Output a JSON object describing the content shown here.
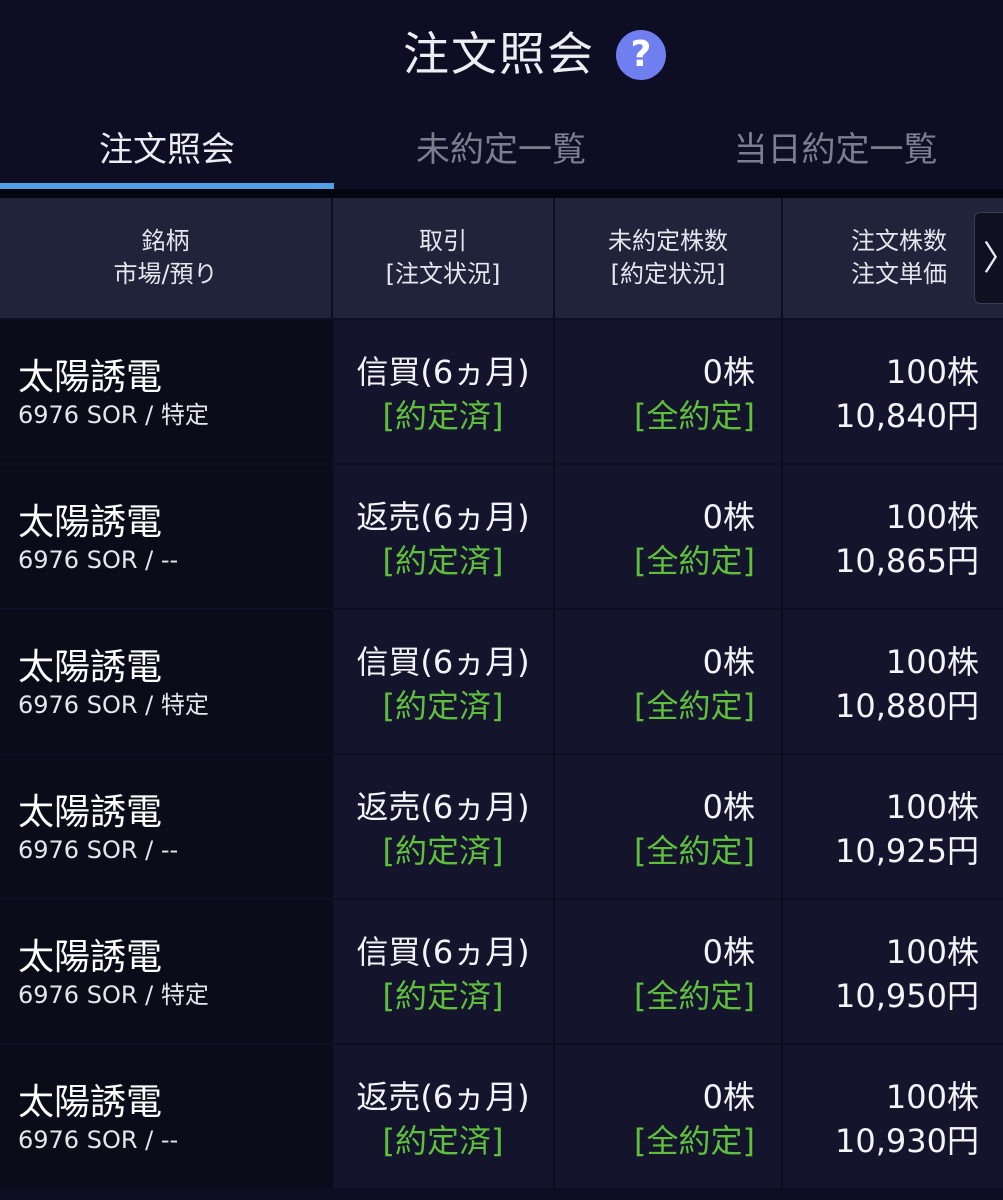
{
  "header": {
    "title": "注文照会",
    "help_icon": "?"
  },
  "tabs": [
    {
      "label": "注文照会",
      "active": true
    },
    {
      "label": "未約定一覧",
      "active": false
    },
    {
      "label": "当日約定一覧",
      "active": false
    }
  ],
  "table": {
    "columns": [
      {
        "line1": "銘柄",
        "line2": "市場/預り"
      },
      {
        "line1": "取引",
        "line2": "[注文状況]"
      },
      {
        "line1": "未約定株数",
        "line2": "[約定状況]"
      },
      {
        "line1": "注文株数",
        "line2": "注文単価"
      }
    ],
    "scroll_arrow": "〉",
    "rows": [
      {
        "name": "太陽誘電",
        "sub": "6976 SOR / 特定",
        "trade": "信買(6ヵ月)",
        "status": "[約定済]",
        "unfilled": "0株",
        "fill_status": "[全約定]",
        "qty": "100株",
        "price": "10,840円"
      },
      {
        "name": "太陽誘電",
        "sub": "6976 SOR / --",
        "trade": "返売(6ヵ月)",
        "status": "[約定済]",
        "unfilled": "0株",
        "fill_status": "[全約定]",
        "qty": "100株",
        "price": "10,865円"
      },
      {
        "name": "太陽誘電",
        "sub": "6976 SOR / 特定",
        "trade": "信買(6ヵ月)",
        "status": "[約定済]",
        "unfilled": "0株",
        "fill_status": "[全約定]",
        "qty": "100株",
        "price": "10,880円"
      },
      {
        "name": "太陽誘電",
        "sub": "6976 SOR / --",
        "trade": "返売(6ヵ月)",
        "status": "[約定済]",
        "unfilled": "0株",
        "fill_status": "[全約定]",
        "qty": "100株",
        "price": "10,925円"
      },
      {
        "name": "太陽誘電",
        "sub": "6976 SOR / 特定",
        "trade": "信買(6ヵ月)",
        "status": "[約定済]",
        "unfilled": "0株",
        "fill_status": "[全約定]",
        "qty": "100株",
        "price": "10,950円"
      },
      {
        "name": "太陽誘電",
        "sub": "6976 SOR / --",
        "trade": "返売(6ヵ月)",
        "status": "[約定済]",
        "unfilled": "0株",
        "fill_status": "[全約定]",
        "qty": "100株",
        "price": "10,930円"
      }
    ]
  },
  "colors": {
    "background": "#0d0d24",
    "header_row": "#202339",
    "status_green": "#5fbf3c",
    "tab_indicator": "#4fa0e6",
    "help_icon": "#6f7ff0"
  }
}
